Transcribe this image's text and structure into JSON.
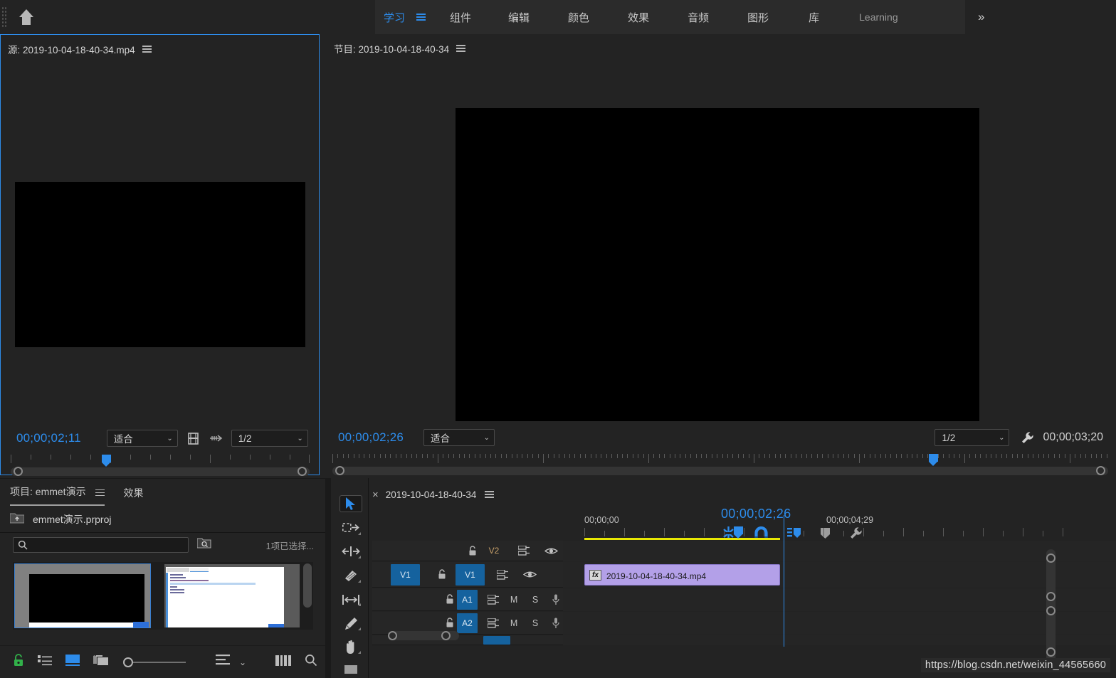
{
  "app": {
    "title": "Adobe Premiere Pro"
  },
  "menubar": {
    "home_icon": "home-icon",
    "items": [
      {
        "label": "学习",
        "active": true
      },
      {
        "label": "组件",
        "active": false
      },
      {
        "label": "编辑",
        "active": false
      },
      {
        "label": "颜色",
        "active": false
      },
      {
        "label": "效果",
        "active": false
      },
      {
        "label": "音频",
        "active": false
      },
      {
        "label": "图形",
        "active": false
      },
      {
        "label": "库",
        "active": false
      },
      {
        "label": "Learning",
        "active": false
      }
    ],
    "overflow_label": "»"
  },
  "source_monitor": {
    "tab_label": "源: 2019-10-04-18-40-34.mp4",
    "playhead_timecode": "00;00;02;11",
    "fit_label": "适合",
    "resolution_label": "1/2",
    "export_frame_icon": "export-frame-icon",
    "drag_icon": "drag-video-icon",
    "controls": [
      {
        "name": "mark-in-icon",
        "glyph": "{←"
      },
      {
        "name": "step-back-icon",
        "glyph": "◀|"
      },
      {
        "name": "play-icon",
        "glyph": "▶"
      },
      {
        "name": "step-forward-icon",
        "glyph": "|▶"
      },
      {
        "name": "mark-out-icon",
        "glyph": "→}"
      },
      {
        "name": "more-options-icon",
        "glyph": "»"
      },
      {
        "name": "button-editor-icon",
        "glyph": "+"
      }
    ]
  },
  "program_monitor": {
    "tab_label": "节目: 2019-10-04-18-40-34",
    "playhead_timecode": "00;00;02;26",
    "fit_label": "适合",
    "resolution_label": "1/2",
    "duration_timecode": "00;00;03;20",
    "settings_icon": "wrench-icon",
    "controls": [
      {
        "name": "add-marker-icon",
        "glyph": "marker"
      },
      {
        "name": "mark-in-icon",
        "glyph": "{"
      },
      {
        "name": "mark-out-icon",
        "glyph": "}"
      },
      {
        "name": "goto-in-icon",
        "glyph": "{←"
      },
      {
        "name": "step-back-icon",
        "glyph": "◀|"
      },
      {
        "name": "play-icon",
        "glyph": "▶"
      },
      {
        "name": "step-forward-icon",
        "glyph": "|▶"
      },
      {
        "name": "goto-out-icon",
        "glyph": "→}"
      },
      {
        "name": "lift-icon",
        "glyph": "lift"
      },
      {
        "name": "extract-icon",
        "glyph": "extract"
      },
      {
        "name": "export-frame-icon",
        "glyph": "camera"
      },
      {
        "name": "comparison-view-icon",
        "glyph": "compare"
      },
      {
        "name": "button-editor-icon",
        "glyph": "+"
      }
    ]
  },
  "project_panel": {
    "tabs": [
      {
        "label": "项目: emmet演示",
        "selected": true
      },
      {
        "label": "效果",
        "selected": false
      }
    ],
    "project_file": "emmet演示.prproj",
    "parent_folder_icon": "folder-up-icon",
    "search_placeholder": "",
    "search_value": "",
    "find_icon": "find-icon",
    "status_text": "1项已选择...",
    "thumbnails": [
      {
        "name": "video-thumbnail",
        "selected": true
      },
      {
        "name": "code-thumbnail",
        "selected": false
      }
    ],
    "toolbar": [
      {
        "name": "lock-icon",
        "glyph": "lock",
        "color": "#32b14a"
      },
      {
        "name": "list-view-icon",
        "glyph": "list"
      },
      {
        "name": "icon-view-icon",
        "glyph": "icon",
        "color": "#2d8ceb"
      },
      {
        "name": "freeform-view-icon",
        "glyph": "freeform"
      },
      {
        "name": "zoom-slider",
        "glyph": "slider"
      },
      {
        "name": "sort-icon",
        "glyph": "sort"
      },
      {
        "name": "sort-dropdown-icon",
        "glyph": "chevron-down"
      },
      {
        "name": "automate-to-sequence-icon",
        "glyph": "bars"
      },
      {
        "name": "find-icon",
        "glyph": "search"
      },
      {
        "name": "new-bin-icon",
        "glyph": "folder"
      }
    ]
  },
  "timeline": {
    "tab_label": "2019-10-04-18-40-34",
    "close_icon": "close-icon",
    "playhead_timecode": "00;00;02;26",
    "toolbar": [
      {
        "name": "linked-selection-icon",
        "glyph": "link",
        "active": true
      },
      {
        "name": "snap-icon",
        "glyph": "magnet",
        "active": true
      },
      {
        "name": "marker-sync-icon",
        "glyph": "marker-sync",
        "active": true
      },
      {
        "name": "add-marker-icon",
        "glyph": "marker",
        "active": false
      },
      {
        "name": "timeline-settings-icon",
        "glyph": "wrench",
        "active": false
      }
    ],
    "ruler_labels": [
      "00;00;00",
      "00;00;04;29"
    ],
    "tracks": [
      {
        "id": "V2",
        "type": "video",
        "selected": false,
        "lock": "unlocked",
        "targeted": false
      },
      {
        "id": "V1",
        "type": "video",
        "selected": true,
        "lock": "unlocked",
        "targeted": true
      },
      {
        "id": "A1",
        "type": "audio",
        "selected": false,
        "lock": "unlocked",
        "targeted": true,
        "mute": "M",
        "solo": "S"
      },
      {
        "id": "A2",
        "type": "audio",
        "selected": false,
        "lock": "unlocked",
        "targeted": true,
        "mute": "M",
        "solo": "S"
      }
    ],
    "clips": [
      {
        "track": "V1",
        "label": "2019-10-04-18-40-34.mp4",
        "fx_badge": "fx",
        "color": "#b3a0e8"
      }
    ]
  },
  "tools": [
    {
      "name": "selection-tool",
      "glyph": "arrow",
      "active": true
    },
    {
      "name": "track-select-forward-tool",
      "glyph": "track-select",
      "active": false
    },
    {
      "name": "ripple-edit-tool",
      "glyph": "ripple",
      "active": false
    },
    {
      "name": "razor-tool",
      "glyph": "razor",
      "active": false
    },
    {
      "name": "slip-tool",
      "glyph": "slip",
      "active": false
    },
    {
      "name": "pen-tool",
      "glyph": "pen",
      "active": false
    },
    {
      "name": "hand-tool",
      "glyph": "hand",
      "active": false
    },
    {
      "name": "zoom-tool",
      "glyph": "zoom",
      "active": false
    }
  ],
  "watermark": {
    "text": "https://blog.csdn.net/weixin_44565660"
  }
}
